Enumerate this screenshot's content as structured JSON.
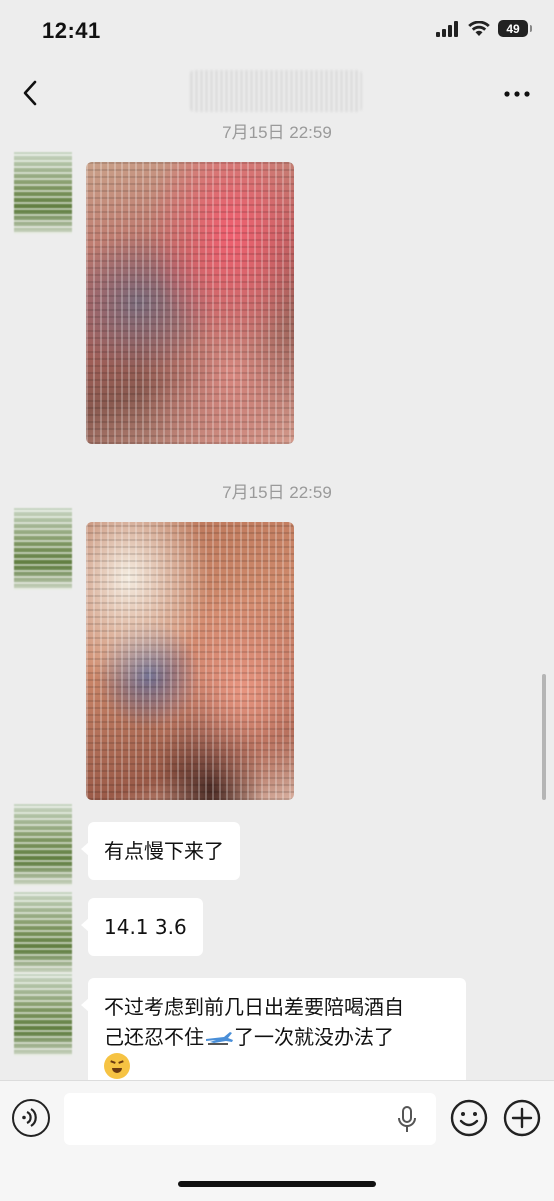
{
  "status_bar": {
    "time": "12:41",
    "battery": "49"
  },
  "nav": {
    "title": ""
  },
  "messages": [
    {
      "type": "timestamp",
      "text": "7月15日 22:59"
    },
    {
      "type": "image",
      "sender": "contact"
    },
    {
      "type": "timestamp",
      "text": "7月15日 22:59"
    },
    {
      "type": "image",
      "sender": "contact"
    },
    {
      "type": "text",
      "sender": "contact",
      "text": "有点慢下来了"
    },
    {
      "type": "text",
      "sender": "contact",
      "text": "14.1 3.6"
    },
    {
      "type": "text",
      "sender": "contact",
      "text_line1": "不过考虑到前几日出差要陪喝酒自",
      "text_line2a": "己还忍不住",
      "text_line2b": "了一次就没办法了"
    }
  ],
  "input_bar": {
    "placeholder": ""
  },
  "icons": [
    "back-icon",
    "more-icon",
    "voice-icon",
    "mic-icon",
    "emoji-icon",
    "plus-icon",
    "wifi-icon",
    "signal-icon",
    "battery-icon",
    "airplane-sticker",
    "pouting-face-emoji"
  ]
}
